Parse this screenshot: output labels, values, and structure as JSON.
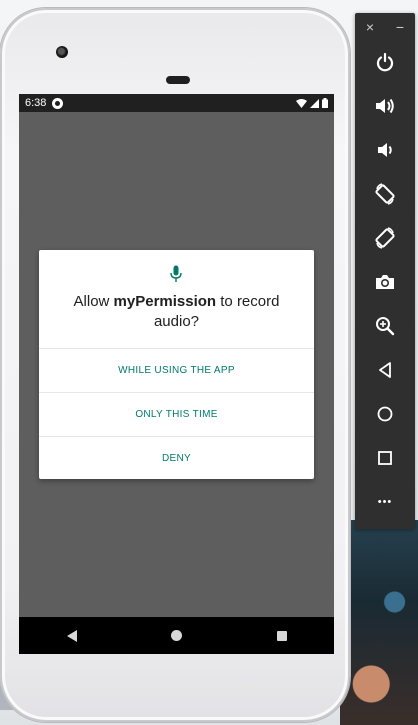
{
  "status_bar": {
    "time": "6:38"
  },
  "dialog": {
    "title_prefix": "Allow ",
    "app_name": "myPermission",
    "title_suffix": " to record audio?",
    "buttons": [
      {
        "label": "WHILE USING THE APP"
      },
      {
        "label": "ONLY THIS TIME"
      },
      {
        "label": "DENY"
      }
    ]
  },
  "toolbar": {
    "close_label": "×",
    "minimize_label": "−",
    "more_label": "•••"
  },
  "colors": {
    "accent": "#00796b",
    "screen_dim": "#5e5e5e",
    "toolbar_bg": "#2f2f2f"
  },
  "icons": {
    "dialog": "mic-icon",
    "toolbar": [
      "power-icon",
      "volume-up-icon",
      "volume-down-icon",
      "rotate-left-icon",
      "rotate-right-icon",
      "camera-icon",
      "zoom-icon",
      "back-icon",
      "home-icon",
      "overview-icon",
      "more-icon"
    ]
  }
}
